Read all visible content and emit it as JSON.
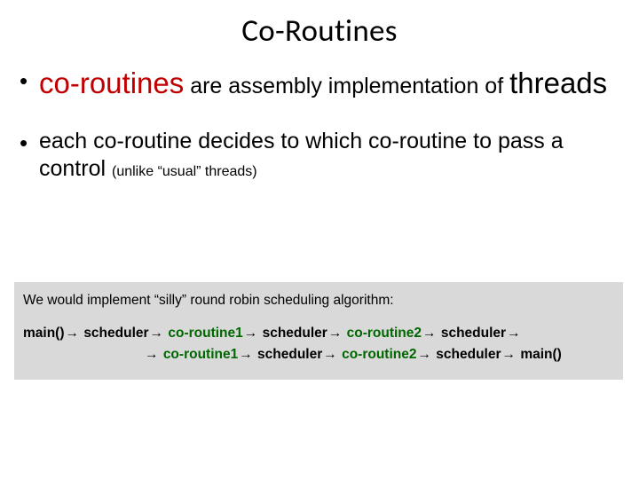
{
  "title": "Co-Routines",
  "bullet1": {
    "co": "co-routines",
    "mid": " are assembly implementation of ",
    "threads": "threads"
  },
  "bullet2": {
    "main": "each co-routine decides to which co-routine to pass a control ",
    "paren": "(unlike “usual” threads)"
  },
  "box": {
    "intro": "We would implement “silly” round robin scheduling algorithm",
    "colon": ":",
    "arrow": "→",
    "seq": {
      "main": "main()",
      "sched": "scheduler",
      "cr1": "co-routine1",
      "cr2": "co-routine2"
    }
  }
}
